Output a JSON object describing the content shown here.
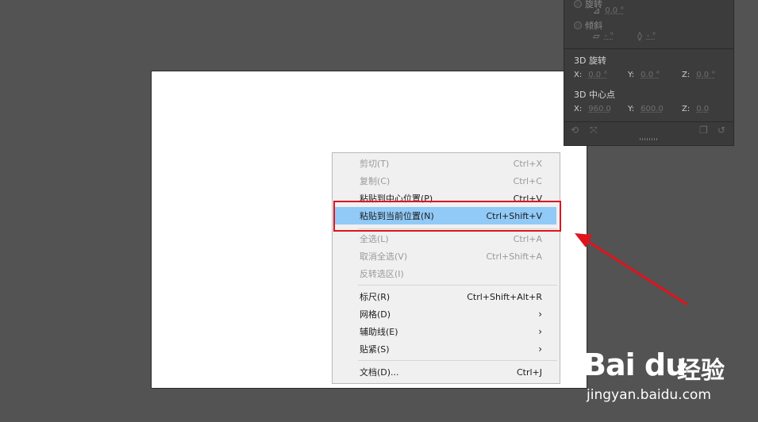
{
  "transform_panel": {
    "rotation_label": "旋转",
    "rotation_value": "0.0 °",
    "skew_label": "倾斜",
    "skew_h_value": "- °",
    "skew_v_value": "- °",
    "rotate3d": {
      "title": "3D 旋转",
      "x_label": "X:",
      "x_value": "0.0 °",
      "y_label": "Y:",
      "y_value": "0.0 °",
      "z_label": "Z:",
      "z_value": "0.0 °"
    },
    "center3d": {
      "title": "3D 中心点",
      "x_label": "X:",
      "x_value": "960.0",
      "y_label": "Y:",
      "y_value": "600.0",
      "z_label": "Z:",
      "z_value": "0.0"
    }
  },
  "context_menu": {
    "items": [
      {
        "label": "剪切(T)",
        "shortcut": "Ctrl+X",
        "disabled": true
      },
      {
        "label": "复制(C)",
        "shortcut": "Ctrl+C",
        "disabled": true
      },
      {
        "label": "粘贴到中心位置(P)",
        "shortcut": "Ctrl+V",
        "disabled": false
      },
      {
        "label": "粘贴到当前位置(N)",
        "shortcut": "Ctrl+Shift+V",
        "disabled": false,
        "highlighted": true
      },
      {
        "label": "全选(L)",
        "shortcut": "Ctrl+A",
        "disabled": true
      },
      {
        "label": "取消全选(V)",
        "shortcut": "Ctrl+Shift+A",
        "disabled": true
      },
      {
        "label": "反转选区(I)",
        "shortcut": "",
        "disabled": true
      },
      {
        "label": "标尺(R)",
        "shortcut": "Ctrl+Shift+Alt+R",
        "disabled": false
      },
      {
        "label": "网格(D)",
        "shortcut": "›",
        "disabled": false
      },
      {
        "label": "辅助线(E)",
        "shortcut": "›",
        "disabled": false
      },
      {
        "label": "贴紧(S)",
        "shortcut": "›",
        "disabled": false
      },
      {
        "label": "文档(D)...",
        "shortcut": "Ctrl+J",
        "disabled": false
      }
    ]
  },
  "annotation": {
    "color": "#e0131d"
  },
  "watermark": {
    "logo": "Bai du",
    "jingyan": "经验",
    "url": "jingyan.baidu.com"
  },
  "colors": {
    "highlight": "#91c9f7",
    "workspace": "#535353",
    "panel": "#3c3c3c"
  }
}
